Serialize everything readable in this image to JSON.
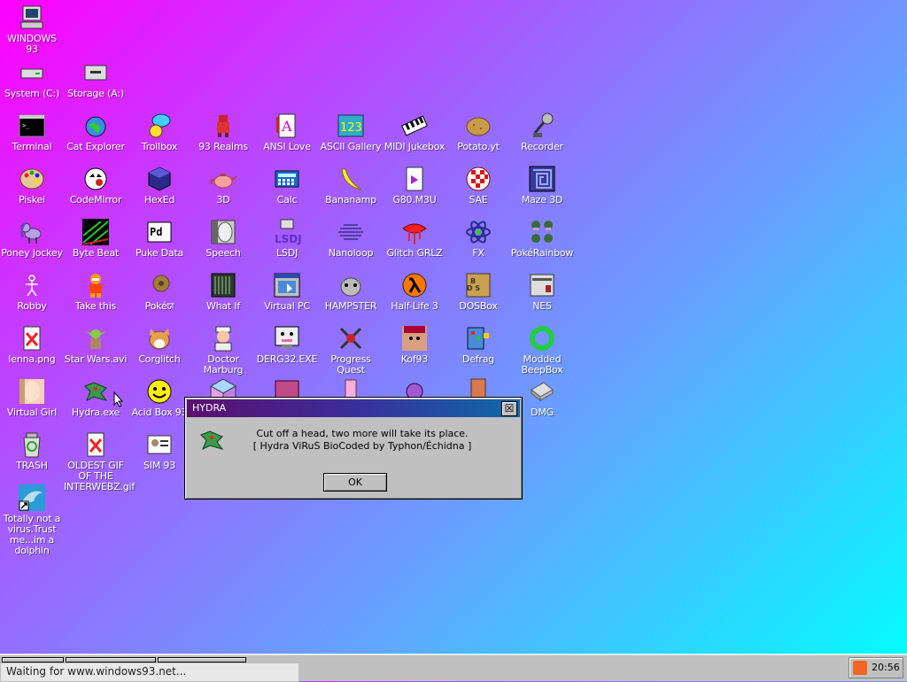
{
  "desktop_icons": [
    {
      "label": "WINDOWS 93",
      "icon": "computer-icon"
    },
    {
      "label": "System (C:)",
      "icon": "drive-icon"
    },
    {
      "label": "Storage (A:)",
      "icon": "floppy-drive-icon"
    },
    {
      "label": "Terminal",
      "icon": "terminal-icon"
    },
    {
      "label": "Cat Explorer",
      "icon": "globe-cat-icon"
    },
    {
      "label": "Trollbox",
      "icon": "chat-bubble-icon"
    },
    {
      "label": "93 Realms",
      "icon": "sprite-icon"
    },
    {
      "label": "ANSI Love",
      "icon": "letter-a-icon"
    },
    {
      "label": "ASCII Gallery",
      "icon": "numbers-icon"
    },
    {
      "label": "MIDI Jukebox",
      "icon": "piano-icon"
    },
    {
      "label": "Potato.yt",
      "icon": "potato-icon"
    },
    {
      "label": "Recorder",
      "icon": "microphone-icon"
    },
    {
      "label": "Piskel",
      "icon": "palette-icon"
    },
    {
      "label": "CodeMirror",
      "icon": "code-cat-icon"
    },
    {
      "label": "HexEd",
      "icon": "cube-icon"
    },
    {
      "label": "3D",
      "icon": "teapot-icon"
    },
    {
      "label": "Calc",
      "icon": "calculator-icon"
    },
    {
      "label": "Bananamp",
      "icon": "banana-icon"
    },
    {
      "label": "G80.M3U",
      "icon": "playlist-file-icon"
    },
    {
      "label": "SAE",
      "icon": "amiga-ball-icon"
    },
    {
      "label": "Maze 3D",
      "icon": "maze-icon"
    },
    {
      "label": "Poney Jockey",
      "icon": "pony-icon"
    },
    {
      "label": "Byte Beat",
      "icon": "waveform-icon"
    },
    {
      "label": "Puke Data",
      "icon": "pd-icon"
    },
    {
      "label": "Speech",
      "icon": "speech-face-icon"
    },
    {
      "label": "LSDJ",
      "icon": "gameboy-icon"
    },
    {
      "label": "Nanoloop",
      "icon": "nanoloop-icon"
    },
    {
      "label": "Glitch GRLZ",
      "icon": "lips-icon"
    },
    {
      "label": "FX",
      "icon": "atom-icon"
    },
    {
      "label": "PokéRainbow",
      "icon": "pokemon-sprites-icon"
    },
    {
      "label": "Robby",
      "icon": "stick-figure-icon"
    },
    {
      "label": "Take this",
      "icon": "character-icon"
    },
    {
      "label": "Pokéਯ",
      "icon": "pokeball-icon"
    },
    {
      "label": "What If",
      "icon": "whatif-icon"
    },
    {
      "label": "Virtual PC",
      "icon": "virtual-pc-icon"
    },
    {
      "label": "HAMPSTER",
      "icon": "hamster-icon"
    },
    {
      "label": "Half-Life 3",
      "icon": "lambda-icon"
    },
    {
      "label": "DOSBox",
      "icon": "dosbox-icon"
    },
    {
      "label": "NES",
      "icon": "nes-icon"
    },
    {
      "label": "lenna.png",
      "icon": "image-file-icon"
    },
    {
      "label": "Star Wars.avi",
      "icon": "yoda-icon"
    },
    {
      "label": "Corglitch",
      "icon": "corgi-icon"
    },
    {
      "label": "Doctor Marburg",
      "icon": "doctor-icon"
    },
    {
      "label": "DERG32.EXE",
      "icon": "monitor-face-icon"
    },
    {
      "label": "Progress Quest",
      "icon": "crossed-swords-icon"
    },
    {
      "label": "Kof93",
      "icon": "fighter-icon"
    },
    {
      "label": "Defrag",
      "icon": "defrag-icon"
    },
    {
      "label": "Modded BeepBox",
      "icon": "ring-icon"
    },
    {
      "label": "Virtual Girl",
      "icon": "face-photo-icon"
    },
    {
      "label": "Hydra.exe",
      "icon": "dragon-icon"
    },
    {
      "label": "Acid Box 93",
      "icon": "smiley-icon"
    },
    {
      "label": "DMG",
      "icon": "dmg-icon"
    },
    {
      "label": "TRASH",
      "icon": "recycle-bin-icon"
    },
    {
      "label": "OLDEST GIF OF THE INTERWEBZ.gif",
      "icon": "image-file-icon"
    },
    {
      "label": "SIM 93",
      "icon": "id-card-icon"
    },
    {
      "label": "Totally not a virus.Trust me...im a dolphin",
      "icon": "dolphin-shortcut-icon"
    }
  ],
  "dialog": {
    "title": "HYDRA",
    "close": "☒",
    "line1": "Cut off a head, two more will take its place.",
    "line2": "[ Hydra ViRuS BioCoded by Typhon/Échidna ]",
    "ok": "OK",
    "icon": "dragon-icon"
  },
  "taskbar": {
    "status": "Waiting for www.windows93.net...",
    "clock": "20:56",
    "tray_icon": "rss-icon"
  },
  "colors": {
    "gradient_start": "#ff00ff",
    "gradient_end": "#00ffff",
    "title_bar": "#3a2e9a",
    "chrome": "#c0c0c0"
  }
}
